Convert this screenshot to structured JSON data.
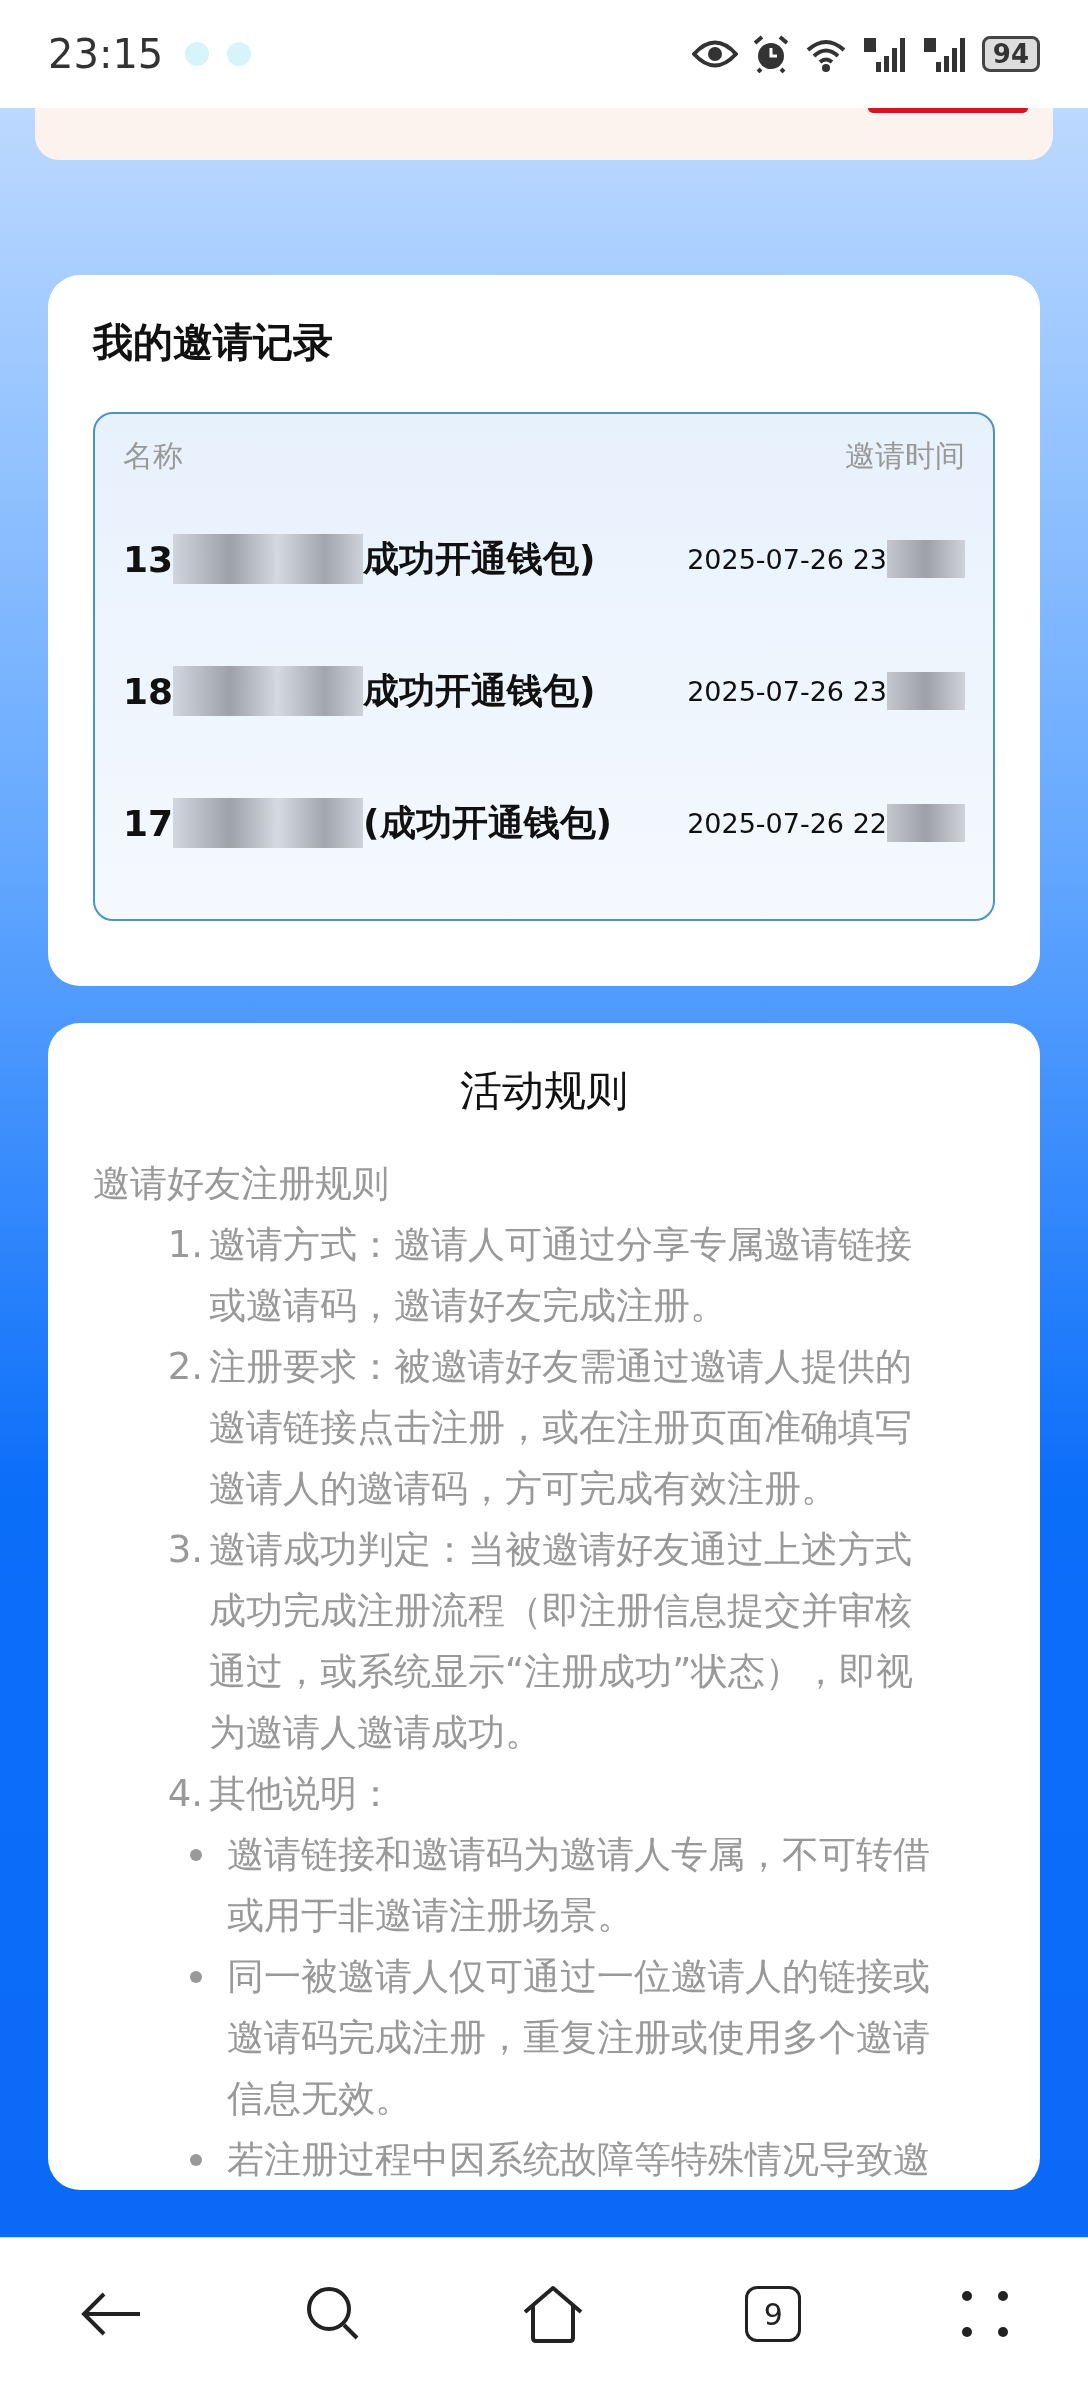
{
  "status_bar": {
    "time": "23:15",
    "battery": "94"
  },
  "invite_records": {
    "title": "我的邀请记录",
    "columns": [
      "名称",
      "邀请时间"
    ],
    "rows": [
      {
        "name_start": "13",
        "name_end": "成功开通钱包)",
        "time": "2025-07-26 23"
      },
      {
        "name_start": "18",
        "name_end": "成功开通钱包)",
        "time": "2025-07-26 23"
      },
      {
        "name_start": "17",
        "name_end": "(成功开通钱包)",
        "time": "2025-07-26 22"
      }
    ]
  },
  "rules": {
    "title": "活动规则",
    "heading": "邀请好友注册规则",
    "items": [
      {
        "number": "1.",
        "text": "邀请方式：邀请人可通过分享专属邀请链接或邀请码，邀请好友完成注册。"
      },
      {
        "number": "2.",
        "text": "注册要求：被邀请好友需通过邀请人提供的邀请链接点击注册，或在注册页面准确填写邀请人的邀请码，方可完成有效注册。"
      },
      {
        "number": "3.",
        "text": "邀请成功判定：当被邀请好友通过上述方式成功完成注册流程（即注册信息提交并审核通过，或系统显示“注册成功”状态），即视为邀请人邀请成功。"
      },
      {
        "number": "4.",
        "text": "其他说明：",
        "children": [
          {
            "text": "邀请链接和邀请码为邀请人专属，不可转借或用于非邀请注册场景。"
          },
          {
            "text": "同一被邀请人仅可通过一位邀请人的链接或邀请码完成注册，重复注册或使用多个邀请信息无效。"
          },
          {
            "text": "若注册过程中因系统故障等特殊情况导致邀"
          }
        ]
      }
    ]
  },
  "nav_bar": {
    "tab_count": "9"
  }
}
